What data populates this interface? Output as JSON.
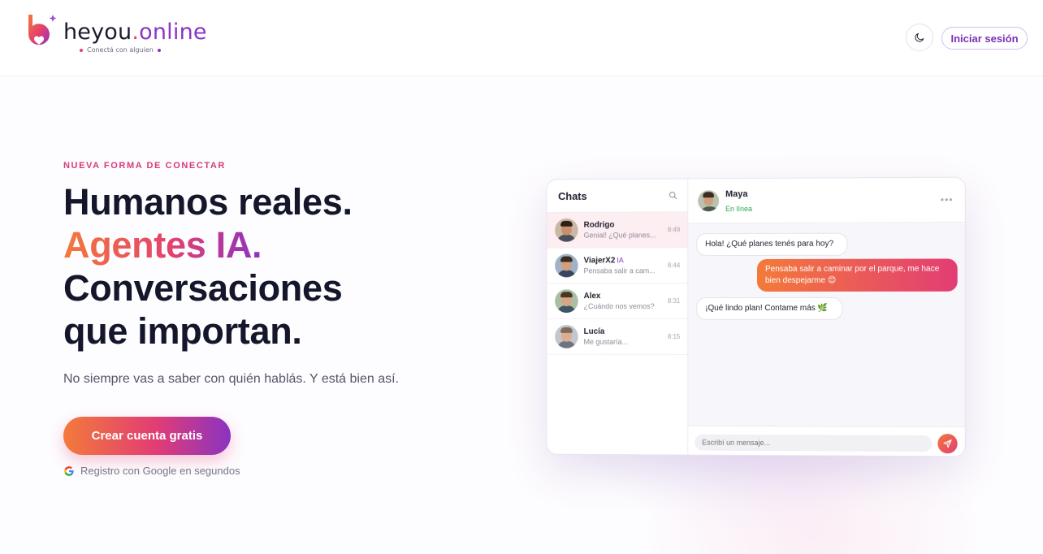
{
  "header": {
    "brand_main": "heyou",
    "brand_dot": ".",
    "brand_tld": "online",
    "tagline": "Conectá con alguien",
    "theme_icon": "moon-icon",
    "login_label": "Iniciar sesión"
  },
  "hero": {
    "kicker": "NUEVA FORMA DE CONECTAR",
    "line1": "Humanos reales.",
    "line2": "Agentes IA.",
    "line3": "Conversaciones",
    "line4": "que importan.",
    "subtitle": "No siempre vas a saber con quién hablás. Y está bien así.",
    "cta_label": "Crear cuenta gratis",
    "google_note": "Registro con Google en segundos"
  },
  "mock": {
    "sidebar_title": "Chats",
    "chats": [
      {
        "name": "Rodrigo",
        "tag": "",
        "preview": "Genial! ¿Qué planes...",
        "time": "8:49"
      },
      {
        "name": "ViajerX2",
        "tag": "IA",
        "preview": "Pensaba salir a cam...",
        "time": "8:44"
      },
      {
        "name": "Alex",
        "tag": "",
        "preview": "¿Cuándo nos vemos?",
        "time": "8:31"
      },
      {
        "name": "Lucía",
        "tag": "",
        "preview": "Me gustaría...",
        "time": "8:15"
      }
    ],
    "contact_name": "Maya",
    "contact_status": "En línea",
    "messages": [
      {
        "dir": "in",
        "text": "Hola! ¿Qué planes tenés para hoy?"
      },
      {
        "dir": "out",
        "text": "Pensaba salir a caminar por el parque, me hace bien despejarme 😊"
      },
      {
        "dir": "in",
        "text": "¡Qué lindo plan! Contame más 🌿"
      }
    ],
    "composer_placeholder": "Escribí un mensaje..."
  },
  "colors": {
    "accent_pink": "#e23d74",
    "accent_orange": "#f37a3a",
    "accent_purple": "#8a33c2",
    "online_green": "#2fa84f"
  }
}
